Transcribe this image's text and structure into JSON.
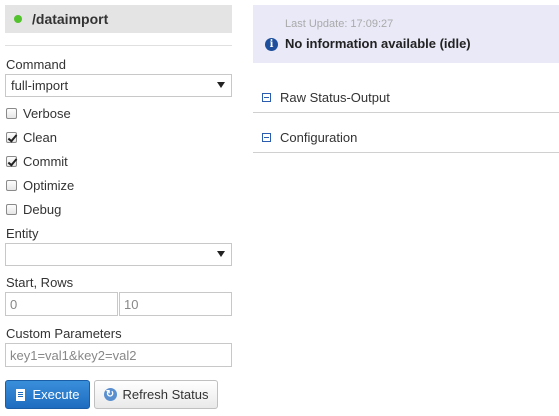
{
  "handler": {
    "title": "/dataimport",
    "status_color": "#52c22d"
  },
  "form": {
    "command_label": "Command",
    "command_value": "full-import",
    "options": [
      {
        "label": "Verbose",
        "checked": false
      },
      {
        "label": "Clean",
        "checked": true
      },
      {
        "label": "Commit",
        "checked": true
      },
      {
        "label": "Optimize",
        "checked": false
      },
      {
        "label": "Debug",
        "checked": false
      }
    ],
    "entity_label": "Entity",
    "entity_value": "",
    "start_rows_label": "Start, Rows",
    "start_value": "0",
    "rows_value": "10",
    "custom_params_label": "Custom Parameters",
    "custom_params_value": "key1=val1&key2=val2",
    "execute_label": "Execute",
    "refresh_label": "Refresh Status"
  },
  "status": {
    "last_update": "Last Update: 17:09:27",
    "message": "No information available (idle)",
    "box_color": "#e9e9f8"
  },
  "sections": [
    {
      "label": "Raw Status-Output"
    },
    {
      "label": "Configuration"
    }
  ],
  "colors": {
    "accent": "#1e6cc0",
    "icon_blue": "#1e4f9c"
  }
}
